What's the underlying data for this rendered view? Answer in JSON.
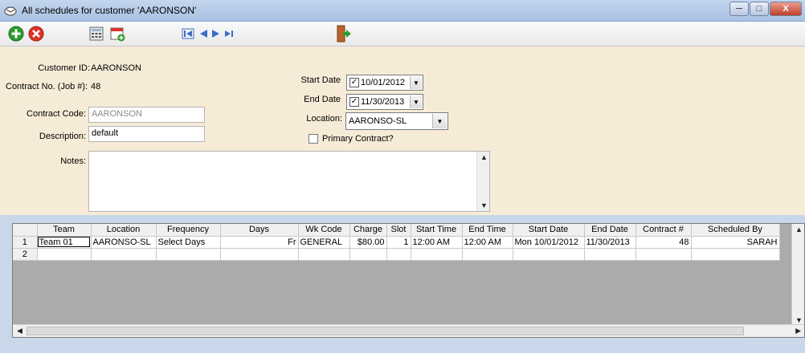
{
  "window": {
    "title": "All schedules for customer 'AARONSON'",
    "minimize": "─",
    "maximize": "□",
    "close": "X"
  },
  "form": {
    "customer_id_label": "Customer ID:",
    "customer_id": "AARONSON",
    "contract_no_label": "Contract No. (Job #):",
    "contract_no": "48",
    "contract_code_label": "Contract Code:",
    "contract_code": "AARONSON",
    "description_label": "Description:",
    "description": "default",
    "notes_label": "Notes:",
    "notes": "",
    "start_date_label": "Start Date",
    "start_date": "10/01/2012",
    "end_date_label": "End Date",
    "end_date": "11/30/2013",
    "location_label": "Location:",
    "location": "AARONSO-SL",
    "primary_label": "Primary Contract?"
  },
  "grid": {
    "columns": [
      "",
      "Team",
      "Location",
      "Frequency",
      "Days",
      "Wk Code",
      "Charge",
      "Slot",
      "Start Time",
      "End Time",
      "Start Date",
      "End Date",
      "Contract #",
      "Scheduled By"
    ],
    "rows": [
      [
        "1",
        "Team 01",
        "AARONSO-SL",
        "Select Days",
        "Fr",
        "GENERAL",
        "$80.00",
        "1",
        "12:00 AM",
        "12:00 AM",
        "Mon 10/01/2012",
        "11/30/2013",
        "48",
        "SARAH"
      ],
      [
        "2",
        "",
        "",
        "",
        "",
        "",
        "",
        "",
        "",
        "",
        "",
        "",
        "",
        ""
      ]
    ]
  },
  "colors": {
    "form_bg": "#f6ebd6",
    "add_green": "#2e9b2e",
    "delete_red": "#d9352a",
    "nav_blue": "#3c6cc4"
  }
}
